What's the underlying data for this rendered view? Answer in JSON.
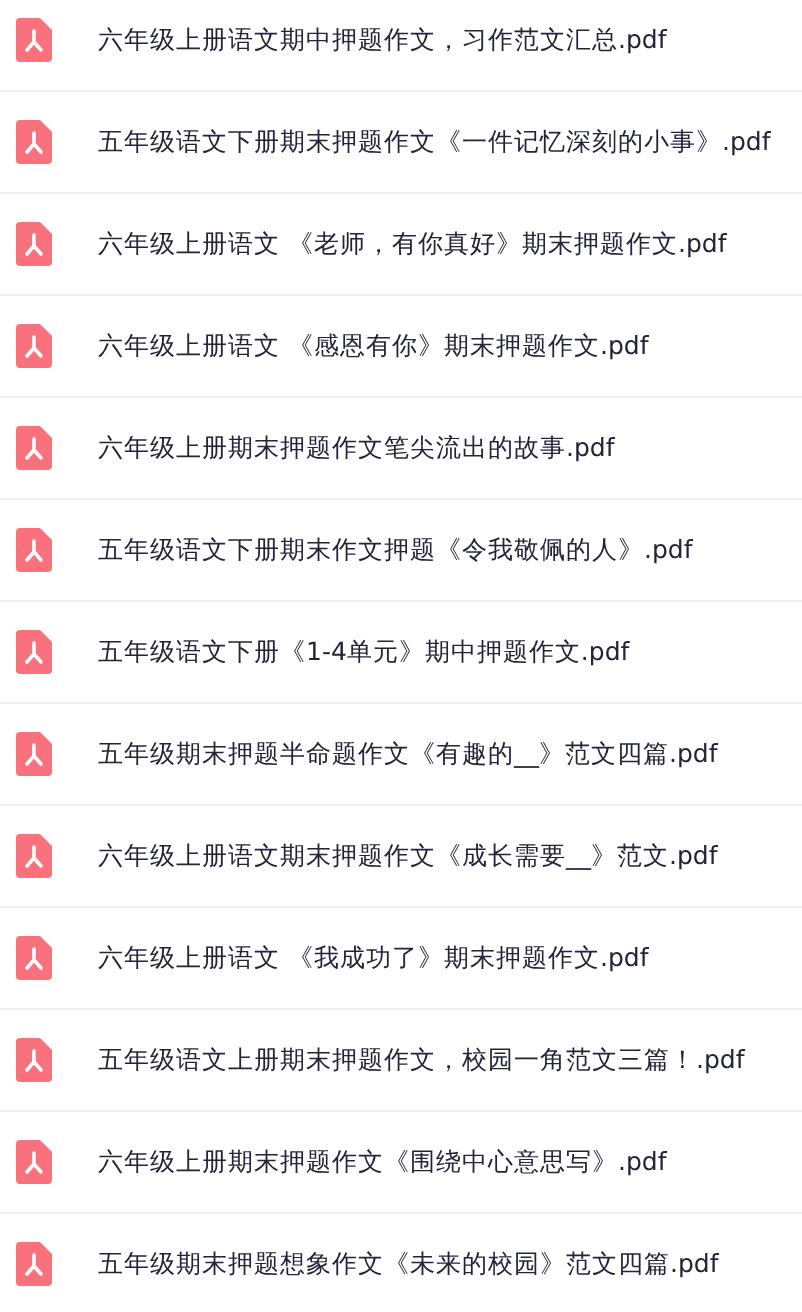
{
  "files": [
    {
      "name": "六年级上册语文期中押题作文，习作范文汇总.pdf"
    },
    {
      "name": "五年级语文下册期末押题作文《一件记忆深刻的小事》.pdf"
    },
    {
      "name": "六年级上册语文 《老师，有你真好》期末押题作文.pdf"
    },
    {
      "name": "六年级上册语文 《感恩有你》期末押题作文.pdf"
    },
    {
      "name": "六年级上册期末押题作文笔尖流出的故事.pdf"
    },
    {
      "name": "五年级语文下册期末作文押题《令我敬佩的人》.pdf"
    },
    {
      "name": "五年级语文下册《1-4单元》期中押题作文.pdf"
    },
    {
      "name": "五年级期末押题半命题作文《有趣的__》范文四篇.pdf"
    },
    {
      "name": "六年级上册语文期末押题作文《成长需要__》范文.pdf"
    },
    {
      "name": "六年级上册语文 《我成功了》期末押题作文.pdf"
    },
    {
      "name": "五年级语文上册期末押题作文，校园一角范文三篇！.pdf"
    },
    {
      "name": "六年级上册期末押题作文《围绕中心意思写》.pdf"
    },
    {
      "name": "五年级期末押题想象作文《未来的校园》范文四篇.pdf"
    }
  ]
}
